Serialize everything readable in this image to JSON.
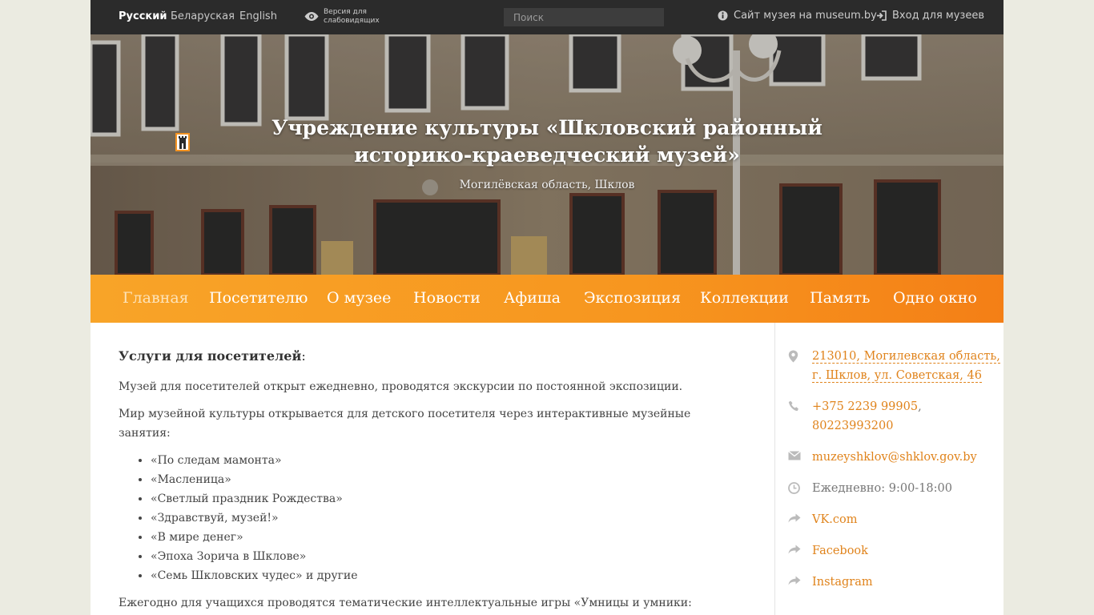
{
  "topbar": {
    "languages": [
      {
        "label": "Русский",
        "active": true
      },
      {
        "label": "Беларуская",
        "active": false
      },
      {
        "label": "English",
        "active": false
      }
    ],
    "low_vision_label": "Версия для слабовидящих",
    "search_placeholder": "Поиск",
    "museum_site_label": "Сайт музея на museum.by",
    "login_label": "Вход для музеев"
  },
  "hero": {
    "title_line1": "Учреждение культуры «Шкловский районный",
    "title_line2": "историко-краеведческий музей»",
    "subtitle": "Могилёвская область, Шклов"
  },
  "nav": {
    "items": [
      {
        "label": "Главная",
        "active": true
      },
      {
        "label": "Посетителю",
        "active": false
      },
      {
        "label": "О музее",
        "active": false
      },
      {
        "label": "Новости",
        "active": false
      },
      {
        "label": "Афиша",
        "active": false
      },
      {
        "label": "Экспозиция",
        "active": false
      },
      {
        "label": "Коллекции",
        "active": false
      },
      {
        "label": "Память",
        "active": false
      },
      {
        "label": "Одно окно",
        "active": false
      }
    ]
  },
  "content": {
    "heading": "Услуги для посетителей",
    "heading_colon": ":",
    "p1": "Музей для посетителей открыт ежедневно, проводятся экскурсии по постоянной экспозиции.",
    "p2": "Мир музейной культуры открывается для детского посетителя через интерактивные музейные занятия:",
    "list": [
      "«По следам мамонта»",
      "«Масленица»",
      "«Светлый праздник Рождества»",
      "«Здравствуй, музей!»",
      "«В мире денег»",
      "«Эпоха Зорича в Шклове»",
      "«Семь Шкловских чудес» и другие"
    ],
    "p3": "Ежегодно для учащихся проводятся тематические интеллектуальные игры «Умницы и умники:"
  },
  "sidebar": {
    "address": "213010, Могилевская область, г. Шклов, ул. Советская, 46",
    "phone1": "+375 2239 99905",
    "phone_sep": ",",
    "phone2": "80223993200",
    "email": "muzeyshklov@shklov.gov.by",
    "hours": "Ежедневно: 9:00-18:00",
    "social": [
      "VK.com",
      "Facebook",
      "Instagram"
    ]
  },
  "colors": {
    "accent": "#f7961f",
    "link": "#e0831b",
    "topbar": "#2b2b2b"
  }
}
